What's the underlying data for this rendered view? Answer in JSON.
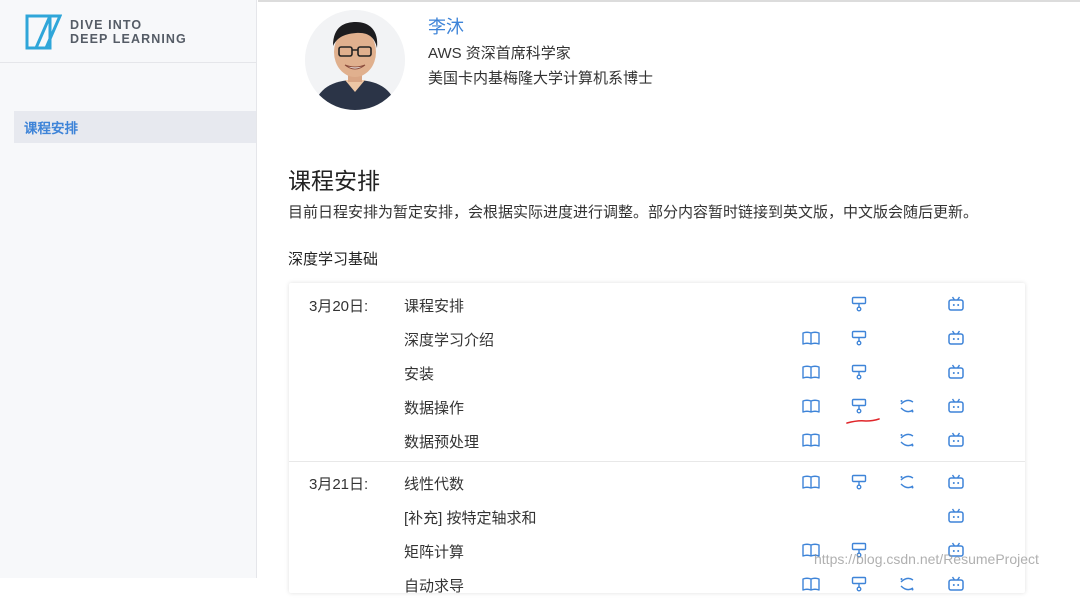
{
  "sidebar": {
    "logo_line1": "DIVE INTO",
    "logo_line2": "DEEP LEARNING",
    "items": [
      {
        "label": "课程安排",
        "active": true
      }
    ]
  },
  "author": {
    "name": "李沐",
    "title": "AWS 资深首席科学家",
    "education": "美国卡内基梅隆大学计算机系博士"
  },
  "main": {
    "section_title": "课程安排",
    "section_desc": "目前日程安排为暂定安排，会根据实际进度进行调整。部分内容暂时链接到英文版，中文版会随后更新。",
    "subsection_title": "深度学习基础"
  },
  "schedule": [
    {
      "date": "3月20日:",
      "topics": [
        {
          "title": "课程安排",
          "icons": [
            "slides-icon",
            "video-icon"
          ]
        },
        {
          "title": "深度学习介绍",
          "icons": [
            "book-icon",
            "slides-icon",
            "video-icon"
          ]
        },
        {
          "title": "安装",
          "icons": [
            "book-icon",
            "slides-icon",
            "video-icon"
          ]
        },
        {
          "title": "数据操作",
          "icons": [
            "book-icon",
            "slides-icon",
            "notebook-icon",
            "video-icon"
          ]
        },
        {
          "title": "数据预处理",
          "icons": [
            "book-icon",
            "notebook-icon",
            "video-icon"
          ]
        }
      ]
    },
    {
      "date": "3月21日:",
      "topics": [
        {
          "title": "线性代数",
          "icons": [
            "book-icon",
            "slides-icon",
            "notebook-icon",
            "video-icon"
          ]
        },
        {
          "title": "[补充] 按特定轴求和",
          "icons": [
            "video-icon"
          ]
        },
        {
          "title": "矩阵计算",
          "icons": [
            "book-icon",
            "slides-icon",
            "video-icon"
          ]
        },
        {
          "title": "自动求导",
          "icons": [
            "book-icon",
            "slides-icon",
            "notebook-icon",
            "video-icon"
          ]
        }
      ]
    }
  ],
  "watermark": "https://blog.csdn.net/ResumeProject",
  "colors": {
    "accent": "#3e84d8",
    "sidebar_bg": "#f7f8fa",
    "annotation": "#e0262a"
  }
}
